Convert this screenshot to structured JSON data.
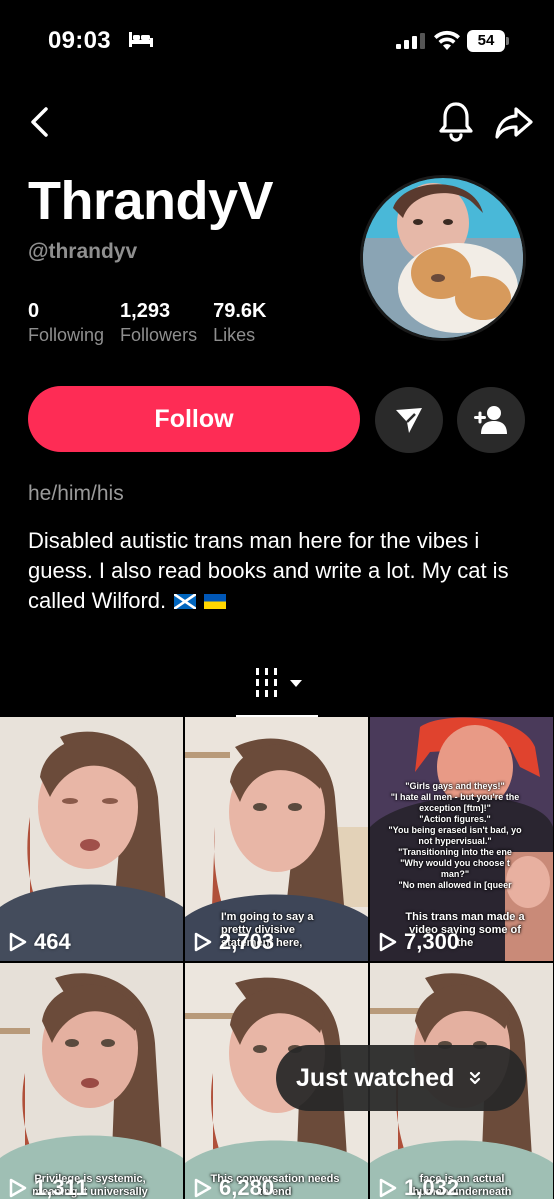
{
  "status_bar": {
    "time": "09:03",
    "battery": "54"
  },
  "profile": {
    "display_name": "ThrandyV",
    "username": "@thrandyv",
    "stats": [
      {
        "value": "0",
        "label": "Following"
      },
      {
        "value": "1,293",
        "label": "Followers"
      },
      {
        "value": "79.6K",
        "label": "Likes"
      }
    ],
    "follow_label": "Follow",
    "pronouns": "he/him/his",
    "bio": "Disabled autistic trans man here for the vibes i guess. I also read books and write a lot. My cat is called Wilford."
  },
  "grid": {
    "videos": [
      {
        "views": "464",
        "caption": ""
      },
      {
        "views": "2,703",
        "caption": "I'm going to say a pretty divisive statement here,"
      },
      {
        "views": "7,300",
        "caption": "This trans man made a video saying some of the"
      },
      {
        "views": "1,311",
        "caption": "Privilege is systemic, meaning it universally"
      },
      {
        "views": "6,280",
        "caption": "This conversation needs to end"
      },
      {
        "views": "1,032",
        "caption": "face is an actual human underneath and"
      }
    ],
    "quote_overlay": [
      "\"Girls gays and theys!\"",
      "\"I hate all men - but you're the",
      "exception [ftm]!\"",
      "\"Action figures.\"",
      "\"You being erased isn't bad, yo",
      "not hypervisual.\"",
      "\"Transitioning into the ene",
      "\"Why would you choose t",
      "man?\"",
      "\"No men allowed in [queer"
    ]
  },
  "just_watched_label": "Just watched",
  "colors": {
    "accent": "#fe2c55",
    "background": "#000000",
    "muted": "#8f8f8f"
  }
}
